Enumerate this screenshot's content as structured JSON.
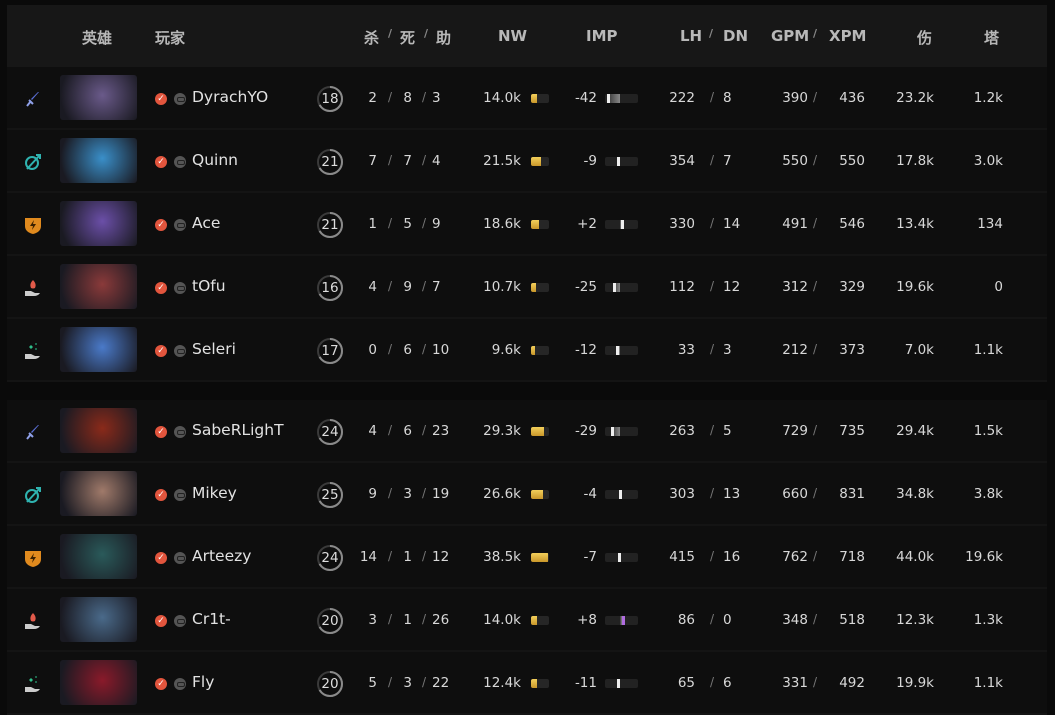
{
  "header": {
    "hero": "英雄",
    "player": "玩家",
    "kills": "杀",
    "deaths": "死",
    "assists": "助",
    "nw": "NW",
    "imp": "IMP",
    "lh": "LH",
    "dn": "DN",
    "gpm": "GPM",
    "xpm": "XPM",
    "damage": "伤",
    "tower": "塔",
    "slash": "/"
  },
  "colors": {
    "check": "#e2553d",
    "nw_bar": "#e8bd45",
    "imp_positive_high": "#b06ce0"
  },
  "teams": [
    {
      "players": [
        {
          "role": "carry-sword-icon",
          "hero_color": "#6a5a8a",
          "name": "DyrachYO",
          "level": "18",
          "k": "2",
          "d": "8",
          "a": "3",
          "nw": "14.0k",
          "imp": "-42",
          "lh": "222",
          "dn": "8",
          "gpm": "390",
          "xpm": "436",
          "dmg": "23.2k",
          "tower": "1.2k"
        },
        {
          "role": "mid-bow-icon",
          "hero_color": "#3a8fc9",
          "name": "Quinn",
          "level": "21",
          "k": "7",
          "d": "7",
          "a": "4",
          "nw": "21.5k",
          "imp": "-9",
          "lh": "354",
          "dn": "7",
          "gpm": "550",
          "xpm": "550",
          "dmg": "17.8k",
          "tower": "3.0k"
        },
        {
          "role": "offlane-shield-icon",
          "hero_color": "#6b4fa8",
          "name": "Ace",
          "level": "21",
          "k": "1",
          "d": "5",
          "a": "9",
          "nw": "18.6k",
          "imp": "+2",
          "lh": "330",
          "dn": "14",
          "gpm": "491",
          "xpm": "546",
          "dmg": "13.4k",
          "tower": "134"
        },
        {
          "role": "support-fire-hand-icon",
          "hero_color": "#8a3a3a",
          "name": "tOfu",
          "level": "16",
          "k": "4",
          "d": "9",
          "a": "7",
          "nw": "10.7k",
          "imp": "-25",
          "lh": "112",
          "dn": "12",
          "gpm": "312",
          "xpm": "329",
          "dmg": "19.6k",
          "tower": "0"
        },
        {
          "role": "support-sparkle-hand-icon",
          "hero_color": "#4a7ac9",
          "name": "Seleri",
          "level": "17",
          "k": "0",
          "d": "6",
          "a": "10",
          "nw": "9.6k",
          "imp": "-12",
          "lh": "33",
          "dn": "3",
          "gpm": "212",
          "xpm": "373",
          "dmg": "7.0k",
          "tower": "1.1k"
        }
      ]
    },
    {
      "players": [
        {
          "role": "carry-sword-icon",
          "hero_color": "#8a2a1a",
          "name": "SabeRLighT",
          "level": "24",
          "k": "4",
          "d": "6",
          "a": "23",
          "nw": "29.3k",
          "imp": "-29",
          "lh": "263",
          "dn": "5",
          "gpm": "729",
          "xpm": "735",
          "dmg": "29.4k",
          "tower": "1.5k"
        },
        {
          "role": "mid-bow-icon",
          "hero_color": "#a07a6a",
          "name": "Mikey",
          "level": "25",
          "k": "9",
          "d": "3",
          "a": "19",
          "nw": "26.6k",
          "imp": "-4",
          "lh": "303",
          "dn": "13",
          "gpm": "660",
          "xpm": "831",
          "dmg": "34.8k",
          "tower": "3.8k"
        },
        {
          "role": "offlane-shield-icon",
          "hero_color": "#2a5a5a",
          "name": "Arteezy",
          "level": "24",
          "k": "14",
          "d": "1",
          "a": "12",
          "nw": "38.5k",
          "imp": "-7",
          "lh": "415",
          "dn": "16",
          "gpm": "762",
          "xpm": "718",
          "dmg": "44.0k",
          "tower": "19.6k"
        },
        {
          "role": "support-fire-hand-icon",
          "hero_color": "#4a6a8a",
          "name": "Cr1t-",
          "level": "20",
          "k": "3",
          "d": "1",
          "a": "26",
          "nw": "14.0k",
          "imp": "+8",
          "lh": "86",
          "dn": "0",
          "gpm": "348",
          "xpm": "518",
          "dmg": "12.3k",
          "tower": "1.3k"
        },
        {
          "role": "support-sparkle-hand-icon",
          "hero_color": "#8a1a2a",
          "name": "Fly",
          "level": "20",
          "k": "5",
          "d": "3",
          "a": "22",
          "nw": "12.4k",
          "imp": "-11",
          "lh": "65",
          "dn": "6",
          "gpm": "331",
          "xpm": "492",
          "dmg": "19.9k",
          "tower": "1.1k"
        }
      ]
    }
  ]
}
